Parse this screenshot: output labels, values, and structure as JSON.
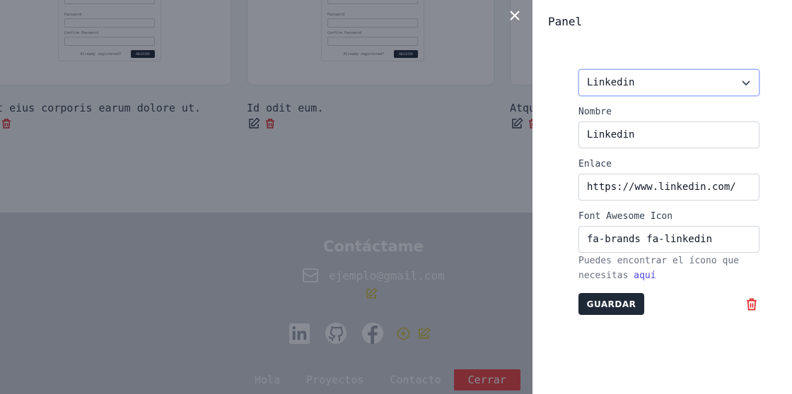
{
  "projects": {
    "mini_form": {
      "field1": "Password",
      "field2": "Confirm Password",
      "link": "Already registered?",
      "button": "REGISTER"
    },
    "items": [
      {
        "title": "Et eius corporis earum dolore ut."
      },
      {
        "title": "Id odit eum."
      },
      {
        "title": "Atque"
      }
    ]
  },
  "contact": {
    "title": "Contáctame",
    "email": "ejemplo@gmail.com",
    "social_icons": [
      "linkedin-icon",
      "github-icon",
      "facebook-icon"
    ]
  },
  "footer_nav": {
    "items": [
      "Hola",
      "Proyectos",
      "Contacto"
    ],
    "close_label": "Cerrar"
  },
  "panel": {
    "title": "Panel",
    "select_value": "Linkedin",
    "name_label": "Nombre",
    "name_value": "Linkedin",
    "link_label": "Enlace",
    "link_value": "https://www.linkedin.com/",
    "icon_label": "Font Awesome Icon",
    "icon_value": "fa-brands fa-linkedin",
    "hint_text": "Puedes encontrar el ícono que necesitas",
    "hint_link": "aquí",
    "save_label": "GUARDAR"
  },
  "colors": {
    "accent_yellow": "#d4c13a",
    "delete_red": "#dc2626",
    "dark_button": "#1f2937",
    "link_blue": "#4f46e5"
  }
}
